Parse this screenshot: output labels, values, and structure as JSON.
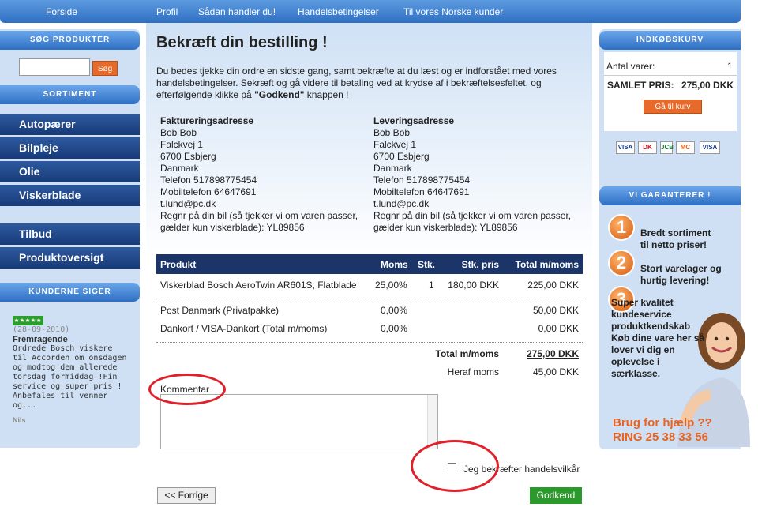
{
  "topnav": {
    "home": "Forside",
    "items": [
      "Profil",
      "Sådan handler du!",
      "Handelsbetingelser",
      "Til vores Norske kunder"
    ]
  },
  "left": {
    "search_title": "SØG PRODUKTER",
    "search_button": "Søg",
    "sortiment_title": "SORTIMENT",
    "categories": [
      "Autopærer",
      "Bilpleje",
      "Olie",
      "Viskerblade"
    ],
    "extra": [
      "Tilbud",
      "Produktoversigt"
    ],
    "reviews_title": "KUNDERNE SIGER",
    "review": {
      "stars": "★★★★★",
      "date": "(28-09-2010)",
      "title": "Fremragende",
      "text": "Ordrede Bosch viskere til Accorden om onsdagen og modtog dem allerede torsdag formiddag !Fin service og super pris ! Anbefales til venner og...",
      "author": "Nils"
    }
  },
  "main": {
    "title": "Bekræft din bestilling !",
    "intro_pre": "Du bedes tjekke din ordre en sidste gang, samt bekræfte at du læst og er indforstået med vores handelsbetingelser. Sekræft og gå videre til betaling ved at krydse af i bekræftelsesfeltet, og efterfølgende klikke på ",
    "intro_bold": "\"Godkend\"",
    "intro_post": " knappen !",
    "billing": {
      "heading": "Faktureringsadresse",
      "lines": [
        "Bob Bob",
        "Falckvej 1",
        "6700 Esbjerg",
        "Danmark",
        "Telefon 517898775454",
        "Mobiltelefon 64647691",
        "t.lund@pc.dk",
        "Regnr på din bil (så tjekker vi om varen passer, gælder kun viskerblade): YL89856"
      ]
    },
    "shipping": {
      "heading": "Leveringsadresse",
      "lines": [
        "Bob Bob",
        "Falckvej 1",
        "6700 Esbjerg",
        "Danmark",
        "Telefon 517898775454",
        "Mobiltelefon 64647691",
        "t.lund@pc.dk",
        "Regnr på din bil (så tjekker vi om varen passer, gælder kun viskerblade): YL89856"
      ]
    },
    "table": {
      "headers": [
        "Produkt",
        "Moms",
        "Stk.",
        "Stk. pris",
        "Total m/moms"
      ],
      "product": [
        "Viskerblad Bosch AeroTwin AR601S, Flatblade",
        "25,00%",
        "1",
        "180,00 DKK",
        "225,00 DKK"
      ],
      "shipping_row": [
        "Post Danmark (Privatpakke)",
        "0,00%",
        "50,00 DKK"
      ],
      "payment_row": [
        "Dankort / VISA-Dankort (Total m/moms)",
        "0,00%",
        "0,00 DKK"
      ],
      "total_label": "Total m/moms",
      "total_value": "275,00 DKK",
      "vat_label": "Heraf moms",
      "vat_value": "45,00 DKK"
    },
    "comment_label": "Kommentar",
    "accept_label": "Jeg bekræfter handelsvilkår",
    "back_button": "<< Forrige",
    "approve_button": "Godkend"
  },
  "right": {
    "cart_title": "INDKØBSKURV",
    "items_label": "Antal varer:",
    "items_value": "1",
    "total_label": "SAMLET PRIS:",
    "total_value": "275,00 DKK",
    "cart_button": "Gå til kurv",
    "cards": [
      "VISA",
      "DK",
      "JCB",
      "MC",
      "VISA"
    ],
    "guarantee_title": "VI GARANTERER !",
    "guarantees": [
      {
        "num": "1",
        "text": "Bredt sortiment til netto priser!"
      },
      {
        "num": "2",
        "text": "Stort varelager og hurtig levering!"
      },
      {
        "num": "3",
        "text": "Super kvalitet kundeservice produktkendskab Køb dine vare her så lover vi dig en oplevelse i særklasse."
      }
    ],
    "help_line1": "Brug for hjælp ??",
    "help_line2": "RING 25 38 33 56"
  }
}
